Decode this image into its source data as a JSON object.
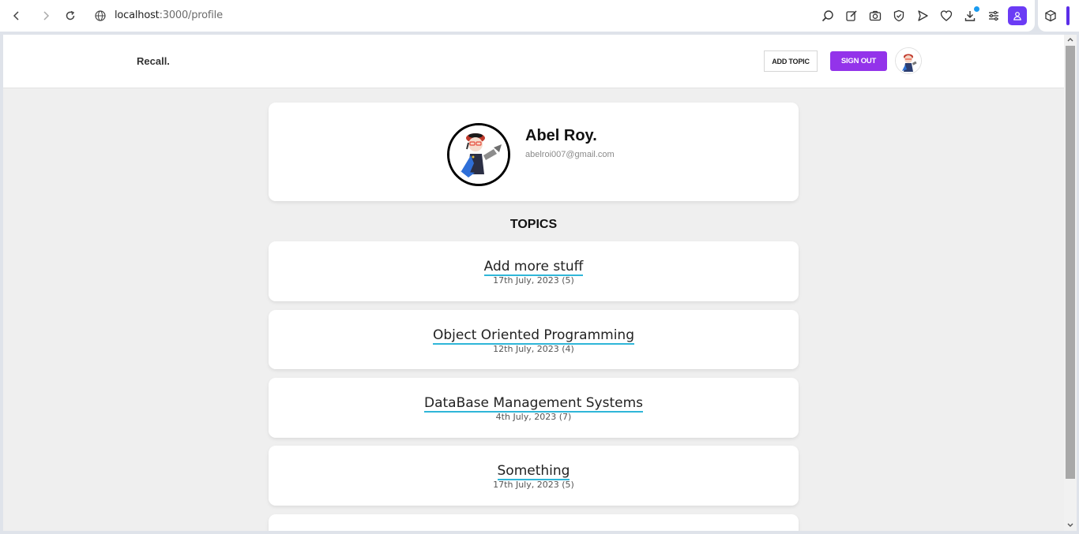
{
  "browser": {
    "url_host": "localhost",
    "url_rest": ":3000/profile",
    "toolbar_icons": [
      "search-icon",
      "edit-icon",
      "camera-icon",
      "shield-check-icon",
      "send-icon",
      "heart-icon",
      "download-icon",
      "menu-icon",
      "profile-icon",
      "extensions-icon"
    ]
  },
  "nav": {
    "brand": "Recall.",
    "add_topic": "ADD TOPIC",
    "sign_out": "SIGN OUT"
  },
  "profile": {
    "name": "Abel Roy.",
    "email": "abelroi007@gmail.com"
  },
  "topics_heading": "TOPICS",
  "topics": [
    {
      "title": "Add more stuff",
      "meta": "17th July, 2023 (5)"
    },
    {
      "title": "Object Oriented Programming",
      "meta": "12th July, 2023 (4)"
    },
    {
      "title": "DataBase Management Systems",
      "meta": "4th July, 2023 (7)"
    },
    {
      "title": "Something",
      "meta": "17th July, 2023 (5)"
    }
  ],
  "colors": {
    "accent": "#9333ea",
    "link_underline": "#2fb6d8",
    "page_bg": "#efefef"
  }
}
